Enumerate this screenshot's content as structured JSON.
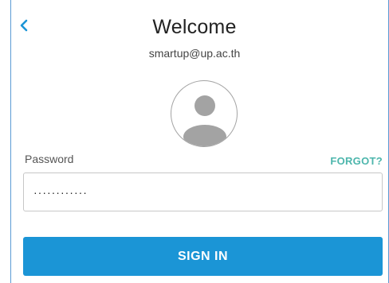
{
  "header": {
    "back_icon": "chevron-left-icon",
    "title": "Welcome",
    "email": "smartup@up.ac.th"
  },
  "avatar": {
    "icon": "user-avatar-icon"
  },
  "password": {
    "label": "Password",
    "forgot_label": "FORGOT?",
    "value": "············"
  },
  "actions": {
    "signin_label": "SIGN IN"
  },
  "colors": {
    "frame_border": "#5b9bd5",
    "back_icon": "#1b95d6",
    "forgot_link": "#4db6ac",
    "signin_button": "#1b95d6",
    "avatar_fill": "#a3a3a3"
  }
}
